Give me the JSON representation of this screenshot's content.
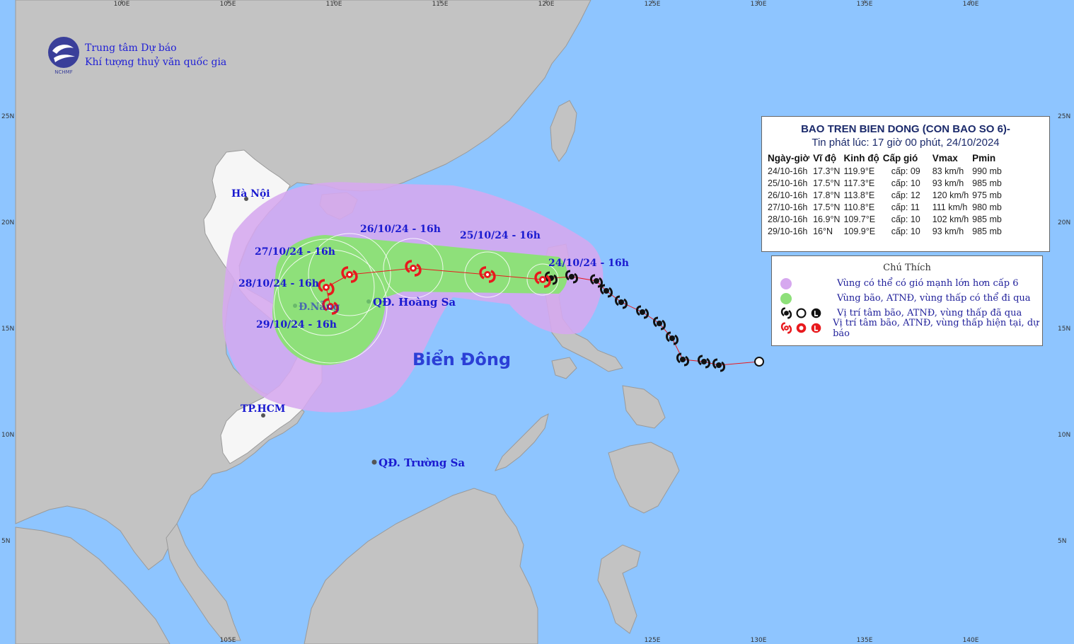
{
  "brand": {
    "logo_text": "NCHMF",
    "line1": "Trung tâm Dự báo",
    "line2": "Khí tượng thuỷ văn quốc gia"
  },
  "axes": {
    "top_lon_labels": [
      "100E",
      "105E",
      "110E",
      "115E",
      "120E",
      "125E",
      "130E",
      "135E",
      "140E"
    ],
    "bottom_lon_labels": [
      "105E",
      "125E",
      "130E",
      "135E",
      "140E"
    ],
    "left_lat_labels": [
      "25N",
      "20N",
      "15N",
      "10N",
      "5N"
    ],
    "right_lat_labels": [
      "25N",
      "20N",
      "15N",
      "10N",
      "5N"
    ]
  },
  "place_labels": {
    "ha_noi": "Hà Nội",
    "da_nang": "Đ.Nẵng",
    "hcm": "TP.HCM",
    "hoang_sa": "QĐ. Hoàng Sa",
    "truong_sa": "QĐ. Trường Sa",
    "sea_name": "Biển Đông"
  },
  "forecast_labels": {
    "d24": "24/10/24 - 16h",
    "d25": "25/10/24 - 16h",
    "d26": "26/10/24 - 16h",
    "d27": "27/10/24 - 16h",
    "d28": "28/10/24 - 16h",
    "d29": "29/10/24 - 16h"
  },
  "info": {
    "title": "BAO TREN BIEN DONG (CON BAO SO 6)-",
    "subtitle": "Tin phát lúc: 17 giờ 00 phút, 24/10/2024",
    "headers": [
      "Ngày-giờ",
      "Vĩ độ",
      "Kinh độ",
      "Cấp gió",
      "Vmax",
      "Pmin"
    ],
    "rows": [
      [
        "24/10-16h",
        "17.3°N",
        "119.9°E",
        "cấp: 09",
        "83 km/h",
        "990 mb"
      ],
      [
        "25/10-16h",
        "17.5°N",
        "117.3°E",
        "cấp: 10",
        "93 km/h",
        "985 mb"
      ],
      [
        "26/10-16h",
        "17.8°N",
        "113.8°E",
        "cấp: 12",
        "120 km/h",
        "975 mb"
      ],
      [
        "27/10-16h",
        "17.5°N",
        "110.8°E",
        "cấp: 11",
        "111 km/h",
        "980 mb"
      ],
      [
        "28/10-16h",
        "16.9°N",
        "109.7°E",
        "cấp: 10",
        "102 km/h",
        "985 mb"
      ],
      [
        "29/10-16h",
        "16°N",
        "109.9°E",
        "cấp: 10",
        "93 km/h",
        "985 mb"
      ]
    ]
  },
  "legend": {
    "title": "Chú Thích",
    "items": [
      {
        "label": "Vùng có thể có gió mạnh lớn hơn cấp 6",
        "color": "#d6a8ef"
      },
      {
        "label": "Vùng bão, ATNĐ, vùng thấp có thể đi qua",
        "color": "#8ee07a"
      },
      {
        "label": "Vị trí tâm bão, ATNĐ, vùng thấp đã qua",
        "color": "#111111"
      },
      {
        "label": "Vị trí tâm bão, ATNĐ, vùng thấp hiện tại, dự báo",
        "color": "#e8191d"
      }
    ]
  },
  "colors": {
    "sea": "#8ec5ff",
    "land": "#c3c3c3",
    "vietnam": "#f6f6f6",
    "wind_zone": "#d6a8ef",
    "cone": "#8ee07a",
    "track": "#e8191d",
    "past": "#111111"
  }
}
